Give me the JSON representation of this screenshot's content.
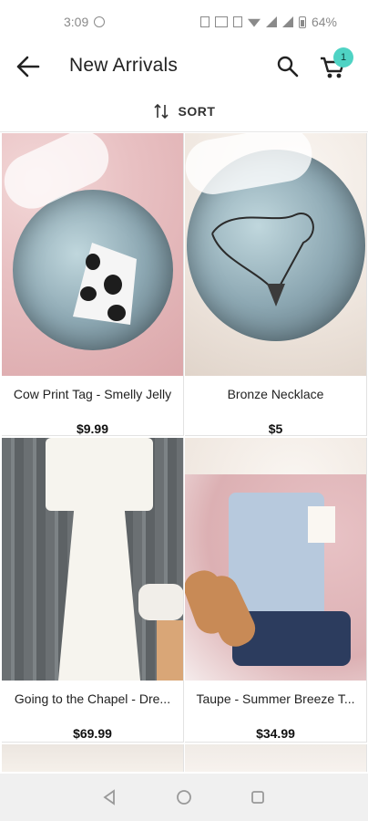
{
  "status_bar": {
    "time": "3:09",
    "battery": "64%"
  },
  "app_bar": {
    "title": "New Arrivals",
    "cart_count": "1"
  },
  "sort": {
    "label": "SORT"
  },
  "products": [
    {
      "name": "Cow Print Tag - Smelly Jelly",
      "price": "$9.99"
    },
    {
      "name": "Bronze Necklace",
      "price": "$5"
    },
    {
      "name": "Going to the Chapel - Dre...",
      "price": "$69.99"
    },
    {
      "name": "Taupe - Summer Breeze T...",
      "price": "$34.99"
    }
  ],
  "colors": {
    "accent_badge": "#4fd3c4",
    "text": "#222222",
    "divider": "#e2e2e2"
  }
}
